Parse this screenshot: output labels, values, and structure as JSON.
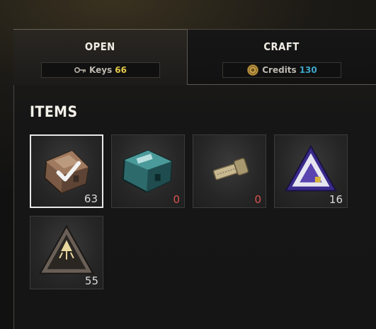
{
  "tabs": {
    "open": {
      "title": "OPEN",
      "currency_label": "Keys",
      "currency_value": "66"
    },
    "craft": {
      "title": "CRAFT",
      "currency_label": "Credits",
      "currency_value": "130"
    }
  },
  "items_section": {
    "title": "ITEMS"
  },
  "items": [
    {
      "name": "bronze-crate",
      "count": "63",
      "selected": true
    },
    {
      "name": "teal-crate",
      "count": "0",
      "selected": false
    },
    {
      "name": "key",
      "count": "0",
      "selected": false
    },
    {
      "name": "purple-triangle-crate",
      "count": "16",
      "selected": false
    },
    {
      "name": "dark-triangle-crate",
      "count": "55",
      "selected": false
    }
  ],
  "colors": {
    "keys_value": "#e3c94a",
    "credits_value": "#3ea6c9",
    "zero_count": "#d9534f",
    "selected_border": "#e8e8e8"
  }
}
